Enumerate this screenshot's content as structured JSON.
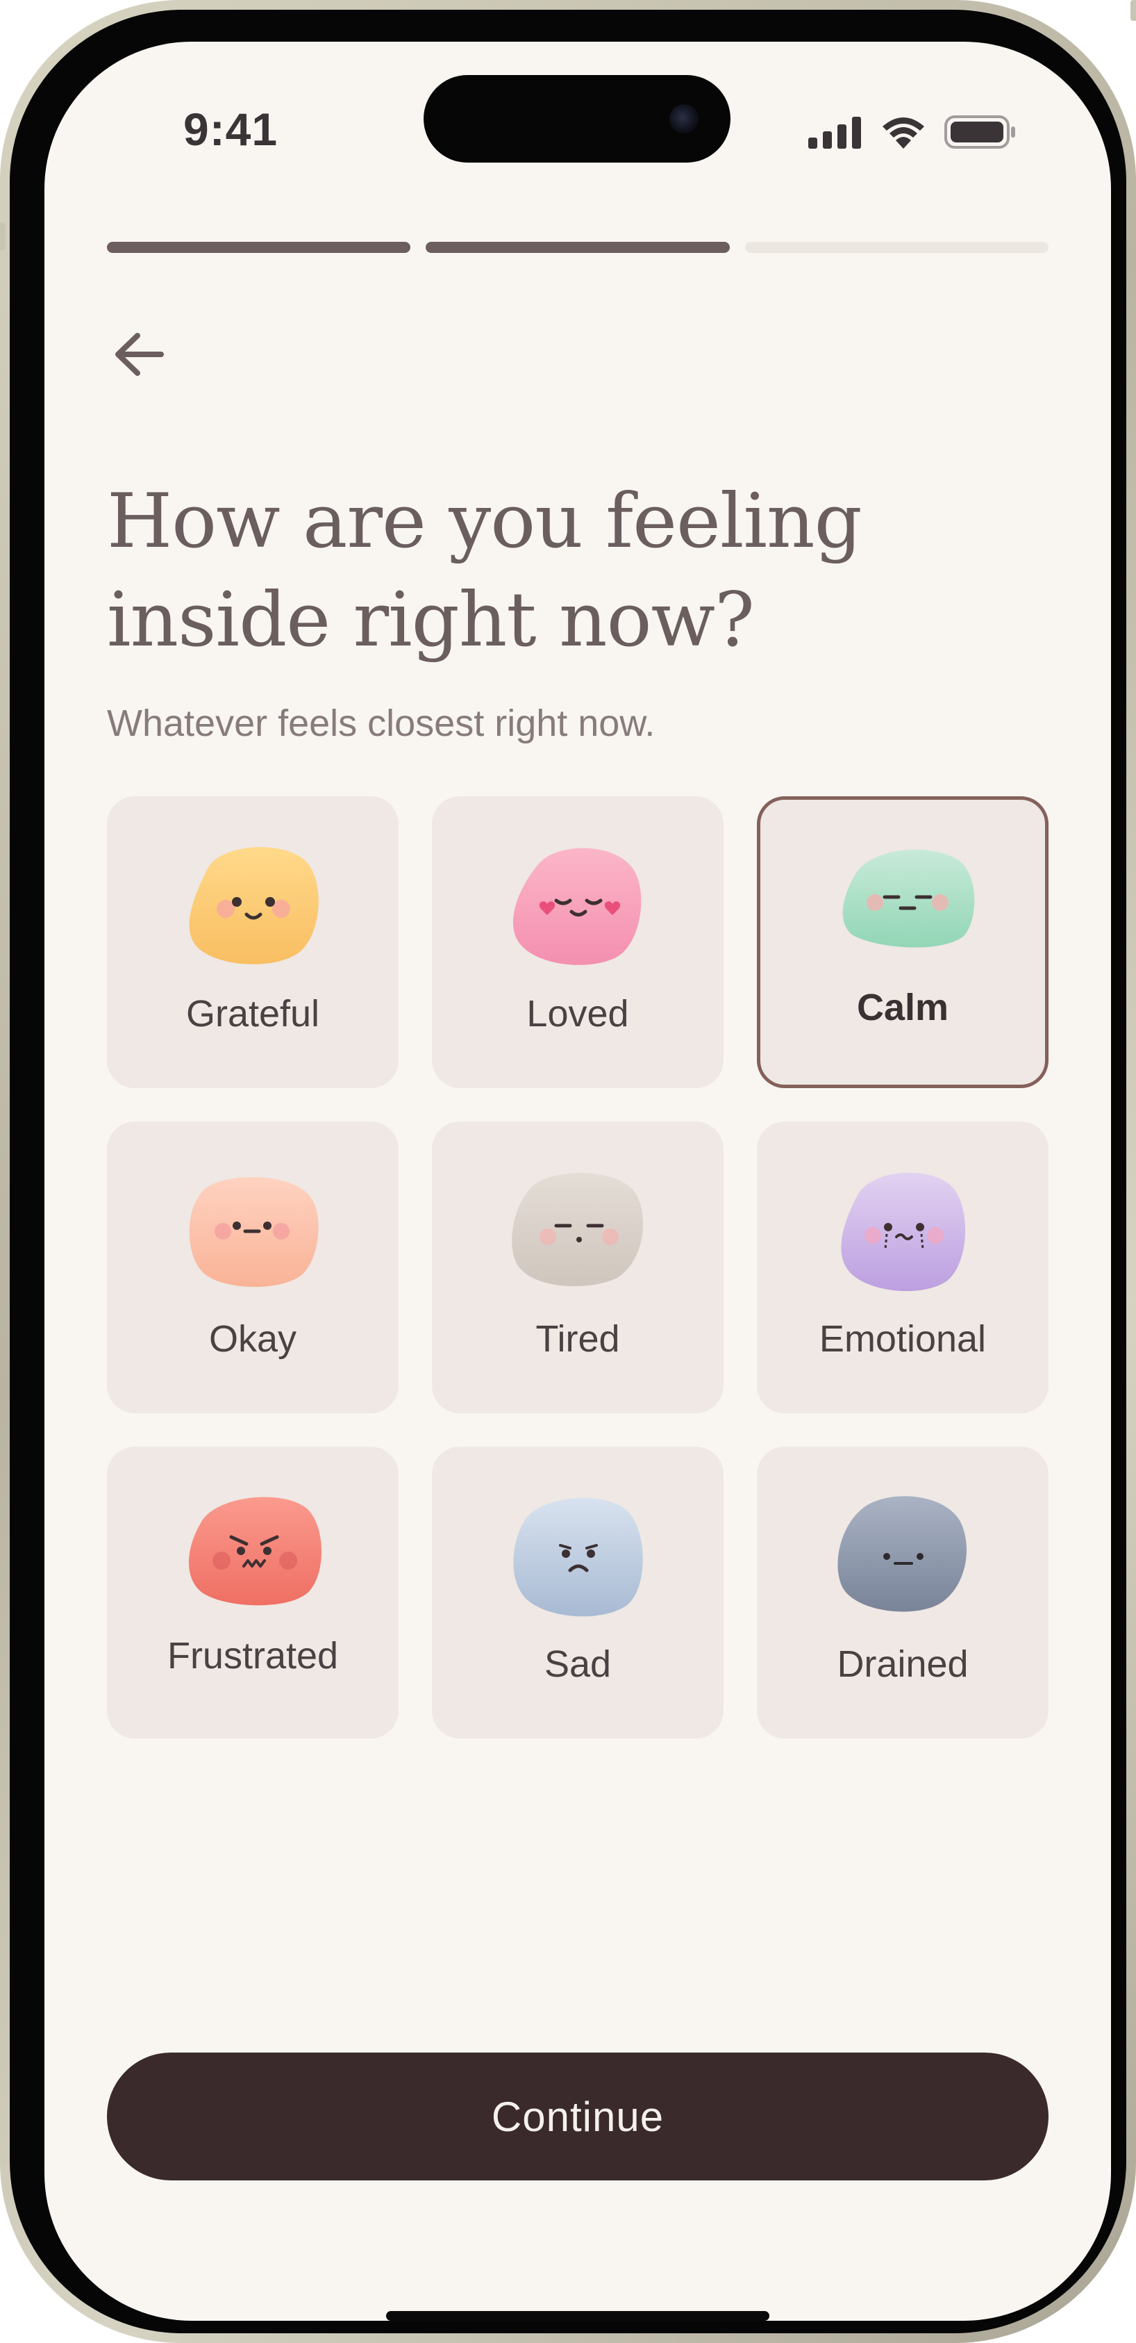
{
  "status_bar": {
    "time": "9:41",
    "icons": [
      "signal-icon",
      "wifi-icon",
      "battery-icon"
    ]
  },
  "progress": {
    "steps_total": 3,
    "steps_done": 2
  },
  "header": {
    "back_icon": "arrow-left-icon",
    "title_line1": "How are you feeling",
    "title_line2": "inside right now?",
    "subtitle": "Whatever feels closest right now."
  },
  "moods": [
    {
      "label": "Grateful",
      "color_top": "#ffd98a",
      "color_bottom": "#f9be62",
      "selected": false
    },
    {
      "label": "Loved",
      "color_top": "#fbb6c8",
      "color_bottom": "#f48fb0",
      "selected": false
    },
    {
      "label": "Calm",
      "color_top": "#c8ead8",
      "color_bottom": "#92d6b6",
      "selected": true
    },
    {
      "label": "Okay",
      "color_top": "#ffd2c0",
      "color_bottom": "#f9b397",
      "selected": false
    },
    {
      "label": "Tired",
      "color_top": "#e4ddd6",
      "color_bottom": "#cfc6bd",
      "selected": false
    },
    {
      "label": "Emotional",
      "color_top": "#e2d2f1",
      "color_bottom": "#bc9fe0",
      "selected": false
    },
    {
      "label": "Frustrated",
      "color_top": "#fb9a8e",
      "color_bottom": "#ef6f63",
      "selected": false
    },
    {
      "label": "Sad",
      "color_top": "#d8e2ef",
      "color_bottom": "#a8bad3",
      "selected": false
    },
    {
      "label": "Drained",
      "color_top": "#a9b3c4",
      "color_bottom": "#7a8499",
      "selected": false
    }
  ],
  "actions": {
    "continue_label": "Continue"
  },
  "colors": {
    "background": "#f9f6f2",
    "card": "#efe8e4",
    "selected_border": "#85605a",
    "title": "#6b5e5f",
    "button": "#3a2a2b",
    "progress_done": "#6c5e5f",
    "progress_todo": "#ece6e1"
  }
}
